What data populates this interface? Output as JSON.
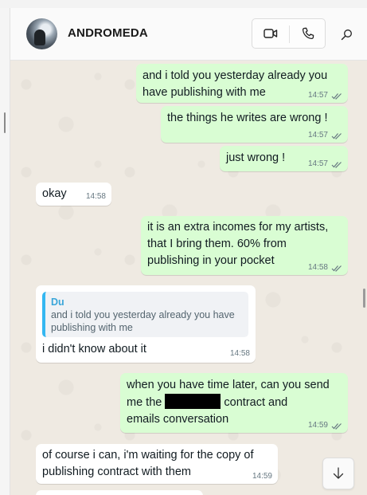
{
  "header": {
    "contact_name": "ANDROMEDA"
  },
  "messages": [
    {
      "direction": "out",
      "lines": [
        "and i told you yesterday already you",
        "have publishing with me"
      ],
      "time": "14:57",
      "status": "read"
    },
    {
      "direction": "out",
      "lines": [
        "the things he writes are wrong !"
      ],
      "time": "14:57",
      "status": "read"
    },
    {
      "direction": "out",
      "lines": [
        "just wrong !"
      ],
      "time": "14:57",
      "status": "read"
    },
    {
      "direction": "in",
      "lines": [
        "okay"
      ],
      "time": "14:58"
    },
    {
      "direction": "out",
      "lines": [
        "it is an extra incomes for my artists,",
        "that I bring them. 60% from",
        "publishing in your pocket"
      ],
      "time": "14:58",
      "status": "read"
    },
    {
      "direction": "in",
      "quote": {
        "author": "Du",
        "lines": [
          "and i told you yesterday already you have",
          "publishing with me"
        ]
      },
      "lines": [
        "i didn't know about it"
      ],
      "time": "14:58"
    },
    {
      "direction": "out",
      "lines": [
        "when you have time later, can you send",
        "me the",
        "contract and",
        "emails conversation"
      ],
      "time": "14:59",
      "status": "read"
    },
    {
      "direction": "in",
      "lines": [
        "of course i can, i'm waiting for the copy of",
        "publishing contract with them"
      ],
      "time": "14:59"
    }
  ],
  "icons": {
    "video_call": "video-camera-icon",
    "voice_call": "phone-icon",
    "search": "search-icon",
    "scroll_down": "arrow-down-icon"
  },
  "colors": {
    "outgoing_bubble": "#d9fdd3",
    "incoming_bubble": "#ffffff",
    "chat_background": "#efeae2",
    "read_ticks": "#667781",
    "quote_accent": "#34b7f1"
  }
}
